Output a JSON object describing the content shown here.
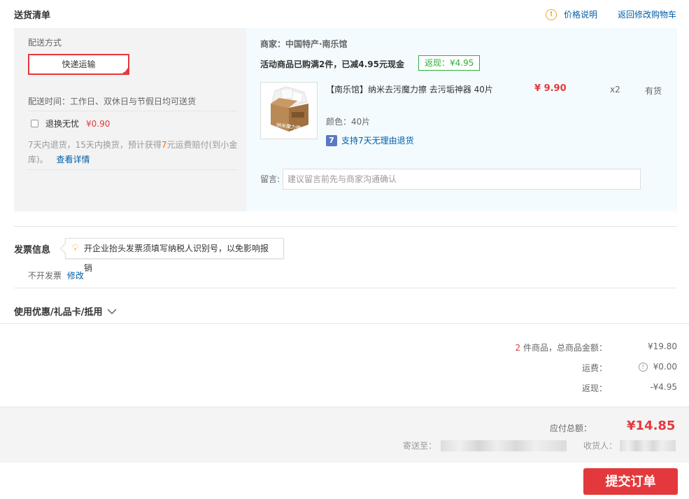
{
  "header": {
    "title": "送货清单",
    "price_note": "价格说明",
    "back_to_cart": "返回修改购物车"
  },
  "shipping": {
    "method_label": "配送方式",
    "method_value": "快递运输",
    "delivery_time": "配送时间：工作日、双休日与节假日均可送货",
    "insurance_label": "退换无忧",
    "insurance_price": "¥0.90",
    "insurance_desc_1": "7天内退货，15天内换货，预计获得",
    "insurance_desc_num": "7",
    "insurance_desc_2": "元运费赔付(到小金",
    "insurance_desc_3": "库)。",
    "insurance_detail": "查看详情"
  },
  "order": {
    "merchant": "商家：中国特产·南乐馆",
    "promo_text": "活动商品已购满2件，已减4.95元现金",
    "promo_tag": "返现：¥4.95",
    "product_name": "【南乐馆】纳米去污魔力擦 去污垢神器 40片",
    "product_price": "¥ 9.90",
    "quantity": "x2",
    "stock": "有货",
    "color": "颜色：40片",
    "return_badge": "7",
    "return_policy": "支持7天无理由退货",
    "product_img_text": "纳米魔力擦",
    "remark_label": "留言:",
    "remark_placeholder": "建议留言前先与商家沟通确认"
  },
  "invoice": {
    "title": "发票信息",
    "tip": "开企业抬头发票须填写纳税人识别号，以免影响报销",
    "value": "不开发票",
    "edit": "修改"
  },
  "coupon": {
    "title": "使用优惠/礼品卡/抵用"
  },
  "summary": {
    "count": "2",
    "count_label": " 件商品，总商品金额：",
    "goods_total": "¥19.80",
    "freight_label": "运费：",
    "freight": "¥0.00",
    "cashback_label": "返现：",
    "cashback": "-¥4.95"
  },
  "total": {
    "label": "应付总额：",
    "amount": "¥14.85",
    "ship_to_label": "寄送至：",
    "receiver_label": "收货人："
  },
  "submit_label": "提交订单",
  "colors": {
    "accent_red": "#e4393c",
    "link_blue": "#005ea7",
    "promo_green": "#2eae3b"
  }
}
